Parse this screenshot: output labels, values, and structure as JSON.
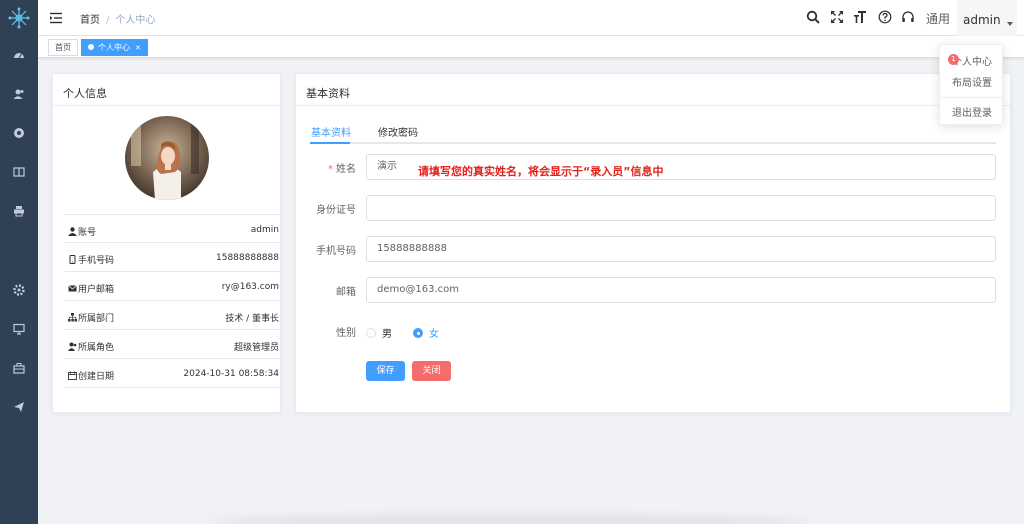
{
  "header": {
    "breadcrumb": [
      "首页",
      "个人中心"
    ],
    "breadcrumb_sep": "/",
    "right_menu": {
      "size_label": "通用",
      "user_name": "admin"
    }
  },
  "tags": [
    {
      "label": "首页",
      "active": false
    },
    {
      "label": "个人中心",
      "active": true
    }
  ],
  "dropdown": {
    "items": [
      "个人中心",
      "布局设置",
      "退出登录"
    ],
    "badge": "1"
  },
  "profile_card": {
    "title": "个人信息",
    "rows": [
      {
        "label": "账号",
        "value": "admin",
        "icon": "user-icon"
      },
      {
        "label": "手机号码",
        "value": "15888888888",
        "icon": "phone-icon"
      },
      {
        "label": "用户邮箱",
        "value": "ry@163.com",
        "icon": "email-icon"
      },
      {
        "label": "所属部门",
        "value": "技术 / 董事长",
        "icon": "tree-icon"
      },
      {
        "label": "所属角色",
        "value": "超级管理员",
        "icon": "peoples-icon"
      },
      {
        "label": "创建日期",
        "value": "2024-10-31 08:58:34",
        "icon": "date-icon"
      }
    ]
  },
  "basic_card": {
    "title": "基本资料",
    "tabs": [
      "基本资料",
      "修改密码"
    ],
    "form": {
      "name_label": "姓名",
      "name_value": "演示",
      "name_hint": "请填写您的真实姓名，将会显示于“录入员”信息中",
      "idcard_label": "身份证号",
      "idcard_value": "",
      "phone_label": "手机号码",
      "phone_value": "15888888888",
      "email_label": "邮箱",
      "email_value": "demo@163.com",
      "gender_label": "性别",
      "gender_options": [
        "男",
        "女"
      ],
      "gender_selected": "女",
      "save_label": "保存",
      "close_label": "关闭"
    }
  },
  "colors": {
    "sidebar": "#304156",
    "primary": "#409eff",
    "danger": "#f56c6c",
    "hint_red": "#e2231a"
  }
}
